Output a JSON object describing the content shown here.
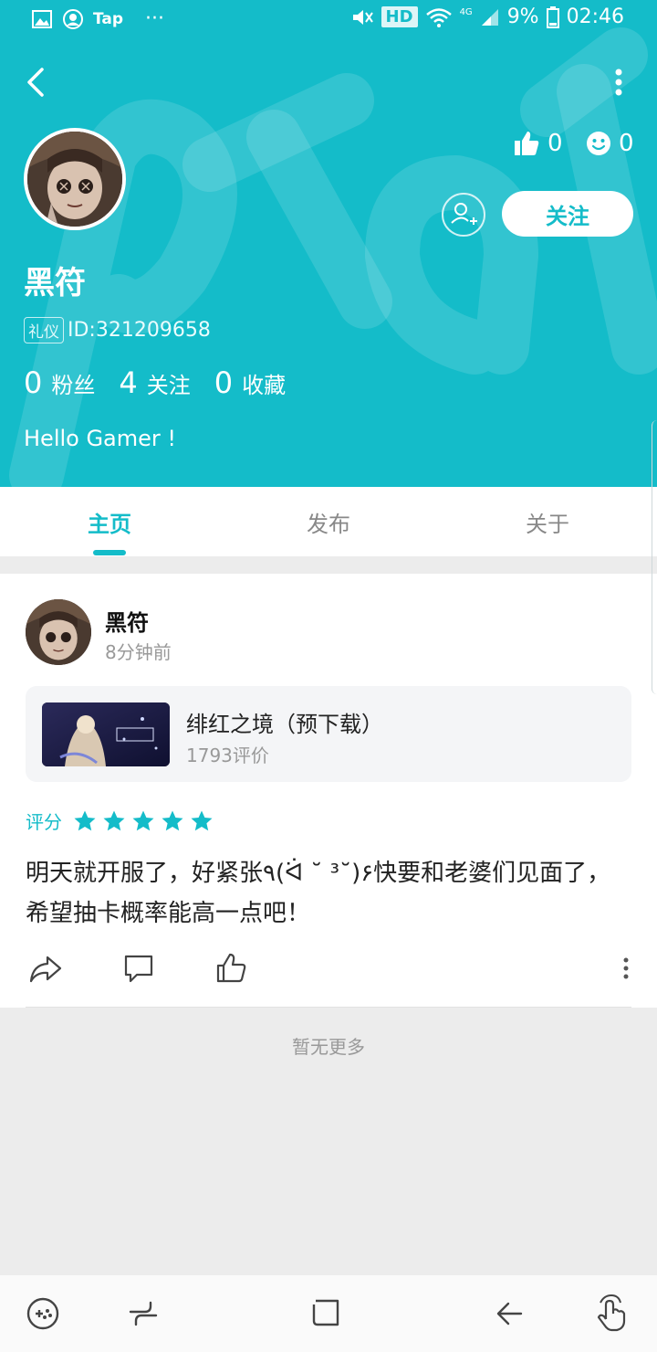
{
  "status_bar": {
    "left_app": "Tap",
    "dots": "···",
    "hd": "HD",
    "network": "4G",
    "battery": "9%",
    "time": "02:46"
  },
  "profile": {
    "username": "黑符",
    "badge": "礼仪",
    "id_text": "ID:321209658",
    "likes_count": "0",
    "reactions_count": "0",
    "follow_label": "关注",
    "stats": [
      {
        "num": "0",
        "label": "粉丝"
      },
      {
        "num": "4",
        "label": "关注"
      },
      {
        "num": "0",
        "label": "收藏"
      }
    ],
    "bio": "Hello Gamer !"
  },
  "tabs": [
    {
      "label": "主页",
      "active": true
    },
    {
      "label": "发布",
      "active": false
    },
    {
      "label": "关于",
      "active": false
    }
  ],
  "post": {
    "author": "黑符",
    "time": "8分钟前",
    "game_title": "绯红之境（预下载）",
    "game_reviews": "1793评价",
    "rating_label": "评分",
    "stars": 5,
    "text": "明天就开服了，好紧张٩(ᐛ ˘ ³˘)۶快要和老婆们见面了，希望抽卡概率能高一点吧！"
  },
  "footer": {
    "no_more": "暂无更多"
  },
  "colors": {
    "accent": "#14bcc9",
    "background": "#ececec"
  }
}
